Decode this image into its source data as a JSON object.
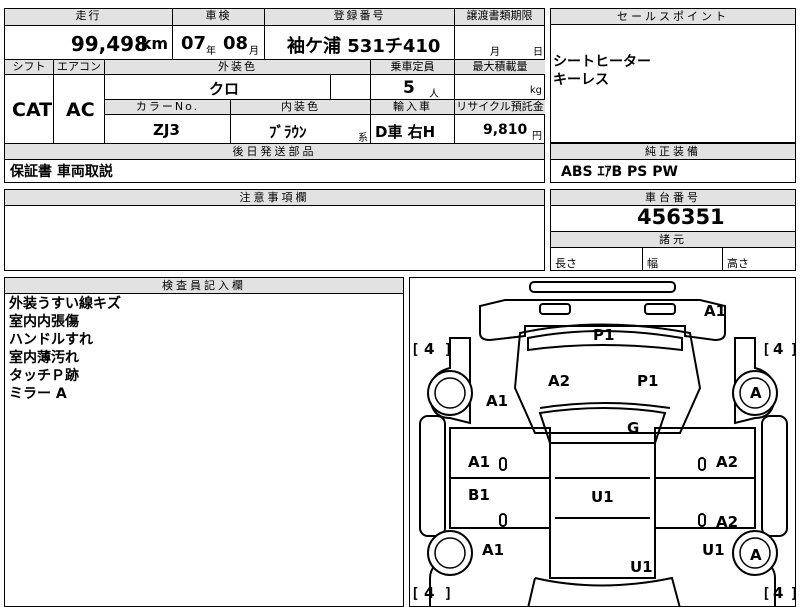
{
  "row1": {
    "mileage_label": "走行",
    "mileage_value": "99,498",
    "mileage_unit": "km",
    "inspection_label": "車検",
    "inspection_year": "07",
    "year_unit": "年",
    "inspection_month": "08",
    "month_unit": "月",
    "registration_label": "登録番号",
    "registration_value": "袖ケ浦 531チ410",
    "transfer_label": "譲渡書類期限",
    "transfer_month_unit": "月",
    "transfer_day_unit": "日"
  },
  "row2": {
    "shift_label": "シフト",
    "shift_value": "CAT",
    "ac_label": "エアコン",
    "ac_value": "AC",
    "color_label": "外装色",
    "color_value": "クロ",
    "capacity_label": "乗車定員",
    "capacity_value": "5",
    "capacity_unit": "人",
    "load_label": "最大積載量",
    "load_unit": "kg",
    "color_no_label": "カラーNo.",
    "color_no_value": "ZJ3",
    "interior_label": "内装色",
    "interior_value": "ﾌﾞﾗｳﾝ",
    "interior_unit": "系",
    "import_label": "輸入車",
    "import_value": "D車 右H",
    "recycle_label": "リサイクル預託金",
    "recycle_value": "9,810",
    "recycle_unit": "円"
  },
  "later": {
    "label": "後日発送部品",
    "value": "保証書 車両取説"
  },
  "selling": {
    "label": "セールスポイント",
    "items": [
      "シートヒーター",
      "キーレス"
    ]
  },
  "equipment": {
    "label": "純正装備",
    "value": "ABS ｴｱB PS PW"
  },
  "notes": {
    "label": "注意事項欄"
  },
  "chassis": {
    "label": "車台番号",
    "value": "456351"
  },
  "dims": {
    "label": "諸元",
    "length": "長さ",
    "width": "幅",
    "height": "高さ"
  },
  "inspector": {
    "label": "検査員記入欄",
    "items": [
      "外装うすい線キズ",
      "室内内張傷",
      "ハンドルすれ",
      "室内薄汚れ",
      "タッチＰ跡",
      "ミラー A"
    ]
  },
  "diagram": {
    "marks": {
      "a1_top_right": "A1",
      "p1_roof": "P1",
      "a2_bonnet": "A2",
      "p1_bonnet": "P1",
      "a1_front_left": "A1",
      "a_front_right_wheel": "A",
      "g_windshield": "G",
      "a1_left_door": "A1",
      "a2_right_door": "A2",
      "b1_left_rear_door": "B1",
      "u1_roof": "U1",
      "a2_right_rear_door": "A2",
      "a1_rear_left": "A1",
      "u1_rear_right": "U1",
      "a_rear_right_wheel": "A",
      "u1_trunk": "U1"
    },
    "tires": {
      "front_left": "4",
      "front_right": "4",
      "rear_left": "4",
      "rear_right": "4"
    }
  }
}
